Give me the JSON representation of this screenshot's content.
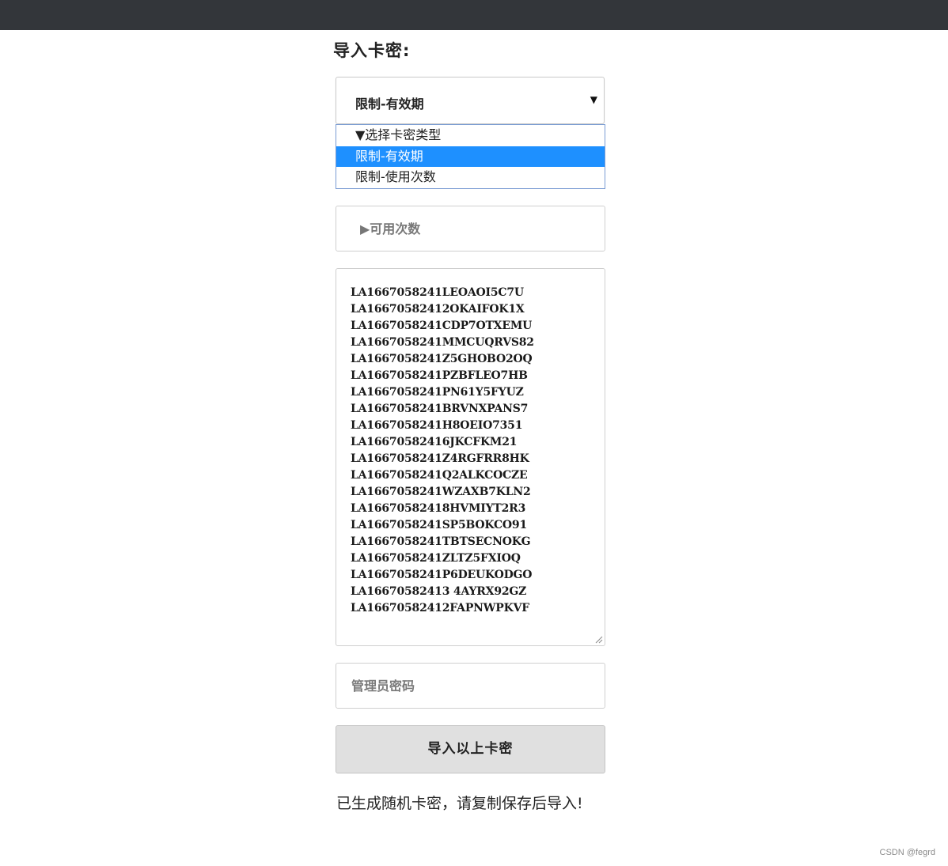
{
  "page": {
    "heading": "导入卡密:"
  },
  "card_type_select": {
    "selected": "限制-有效期",
    "options": [
      "▼选择卡密类型",
      "限制-有效期",
      "限制-使用次数"
    ],
    "selected_index": 1,
    "highlight_color": "#1e90ff"
  },
  "use_count_input": {
    "placeholder": "▶可用次数",
    "value": ""
  },
  "codes_textarea": {
    "codes": [
      "LA1667058241LEOAOI5C7U",
      "LA16670582412OKAIFOK1X",
      "LA1667058241CDP7OTXEMU",
      "LA1667058241MMCUQRVS82",
      "LA1667058241Z5GHOBO2OQ",
      "LA1667058241PZBFLEO7HB",
      "LA1667058241PN61Y5FYUZ",
      "LA1667058241BRVNXPANS7",
      "LA1667058241H8OEIO7351",
      "LA16670582416JKCFKM21",
      "LA1667058241Z4RGFRR8HK",
      "LA1667058241Q2ALKCOCZE",
      "LA1667058241WZAXB7KLN2",
      "LA16670582418HVMIYT2R3",
      "LA1667058241SP5BOKCO91",
      "LA1667058241TBTSECNOKG",
      "LA1667058241ZLTZ5FXIOQ",
      "LA1667058241P6DEUKODGO",
      "LA16670582413 4AYRX92GZ",
      "LA16670582412FAPNWPKVF"
    ]
  },
  "admin_password_input": {
    "placeholder": "管理员密码",
    "value": ""
  },
  "import_button": {
    "label": "导入以上卡密"
  },
  "status_message": "已生成随机卡密，请复制保存后导入!",
  "watermark": "CSDN @fegrd",
  "colors": {
    "topbar": "#33363a",
    "button_bg": "#e0e0e0"
  }
}
